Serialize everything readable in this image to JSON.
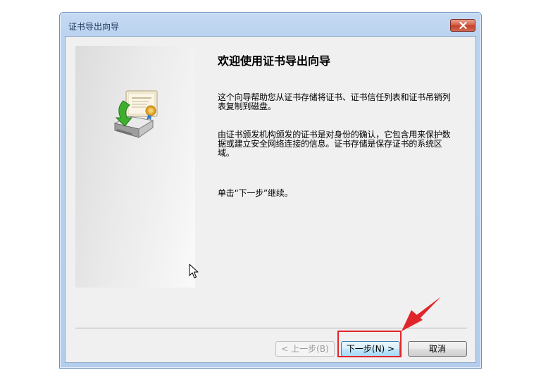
{
  "window": {
    "title": "证书导出向导"
  },
  "wizard": {
    "heading": "欢迎使用证书导出向导",
    "paragraph1": "这个向导帮助您从证书存储将证书、证书信任列表和证书吊销列表复制到磁盘。",
    "paragraph2": "由证书颁发机构颁发的证书是对身份的确认，它包含用来保护数据或建立安全网络连接的信息。证书存储是保存证书的系统区域。",
    "paragraph3": "单击“下一步”继续。"
  },
  "buttons": {
    "back": "< 上一步(B)",
    "next": "下一步(N) >",
    "cancel": "取消"
  },
  "icons": {
    "close": "close-icon",
    "wizard": "certificate-export-icon",
    "cursor": "mouse-cursor-icon"
  },
  "colors": {
    "annotation": "#e0262b",
    "titlebar": "#bad2ef",
    "client": "#f0f0f0",
    "close_button": "#c2402a"
  }
}
